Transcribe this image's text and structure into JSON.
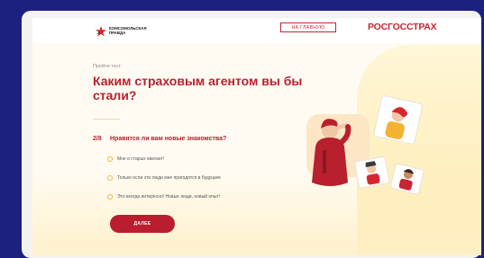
{
  "header": {
    "brand_kp": "Комсомольская правда",
    "home_button": "НА ГЛАВНУЮ",
    "brand_rgs": "РОСГОССТРАХ"
  },
  "quiz": {
    "crumb": "Пройти тест",
    "title": "Каким страховым агентом вы бы стали?",
    "progress": "2/8",
    "question": "Нравятся ли вам новые знакомства?",
    "options": [
      "Мне и старых хватает!",
      "Только если эти люди мне пригодятся в будущем",
      "Это всегда интересно! Новые люди, новый опыт!"
    ],
    "next_button": "ДАЛЕЕ"
  },
  "colors": {
    "accent": "#b8202e",
    "radio": "#f2b233",
    "background": "#1c2180"
  }
}
